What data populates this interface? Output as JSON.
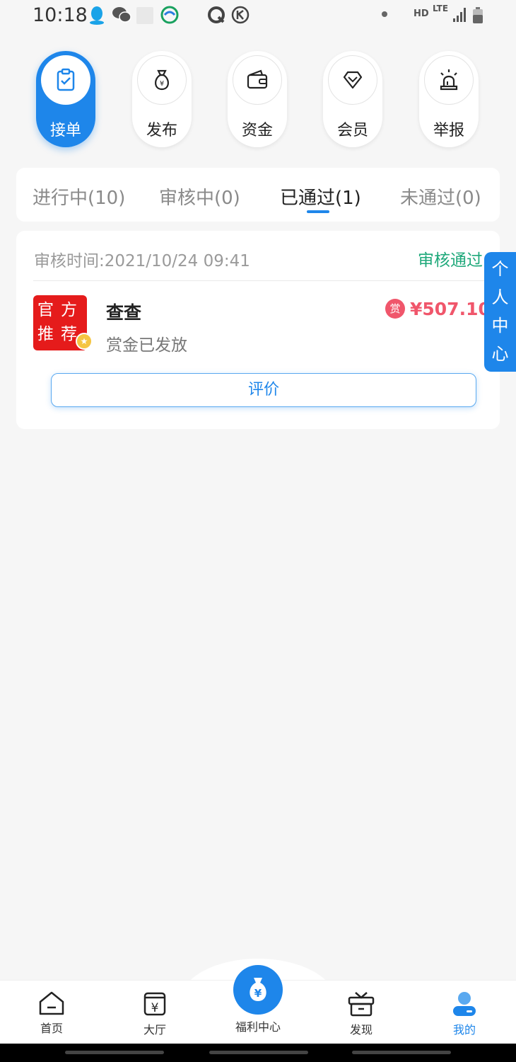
{
  "status_bar": {
    "time": "10:18",
    "hd": "HD",
    "lte": "LTE",
    "icons": [
      "qq-icon",
      "wechat-icon",
      "blank-notification-icon",
      "china-mobile-icon",
      "q-circle-icon",
      "k-circle-icon",
      "dot-icon",
      "signal-icon",
      "battery-icon"
    ]
  },
  "quick_entries": [
    {
      "label": "接单",
      "icon": "clipboard-check-icon",
      "active": true
    },
    {
      "label": "发布",
      "icon": "money-bag-icon",
      "active": false
    },
    {
      "label": "资金",
      "icon": "wallet-icon",
      "active": false
    },
    {
      "label": "会员",
      "icon": "diamond-icon",
      "active": false
    },
    {
      "label": "举报",
      "icon": "alarm-siren-icon",
      "active": false
    }
  ],
  "tabs": [
    {
      "label": "进行中(10)",
      "active": false
    },
    {
      "label": "审核中(0)",
      "active": false
    },
    {
      "label": "已通过(1)",
      "active": true
    },
    {
      "label": "未通过(0)",
      "active": false
    }
  ],
  "order": {
    "review_time": "审核时间:2021/10/24 09:41",
    "status": "审核通过",
    "logo_text": "官方推荐",
    "title": "查查",
    "subtitle": "赏金已发放",
    "reward_badge": "赏",
    "reward_amount": "¥507.10",
    "comment_button": "评价"
  },
  "side_tab": {
    "chars": [
      "个",
      "人",
      "中",
      "心"
    ]
  },
  "bottom_nav": {
    "items": [
      {
        "label": "首页",
        "icon": "home-icon",
        "active": false
      },
      {
        "label": "大厅",
        "icon": "hall-yen-icon",
        "active": false
      },
      {
        "label": "福利中心",
        "icon": "yen-money-bag-icon",
        "active": false
      },
      {
        "label": "发现",
        "icon": "gift-box-icon",
        "active": false
      },
      {
        "label": "我的",
        "icon": "user-profile-icon",
        "active": true
      }
    ]
  },
  "colors": {
    "accent": "#1e86ea",
    "success": "#1ea87a",
    "reward": "#f0566b",
    "logo_red": "#e51b1b"
  }
}
